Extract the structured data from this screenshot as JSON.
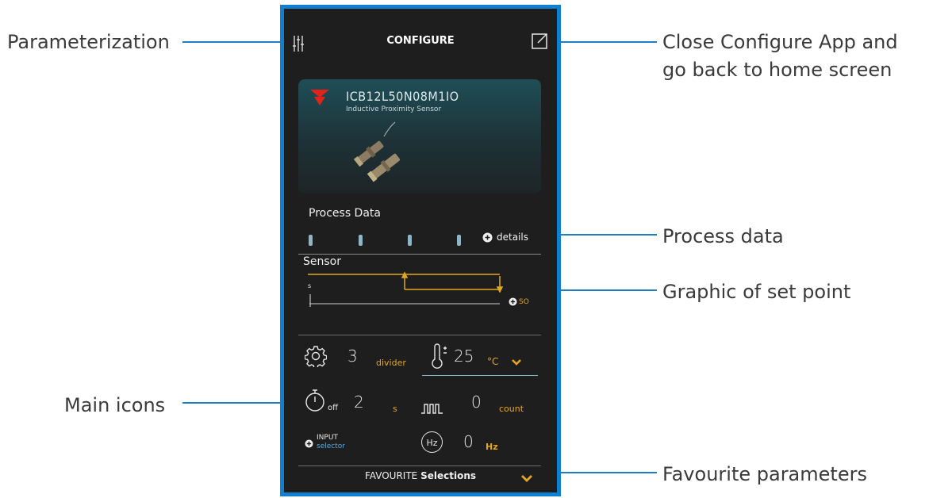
{
  "annotations": {
    "parameterization": "Parameterization",
    "close_app_line1": "Close Configure App and",
    "close_app_line2": "go back to home screen",
    "process_data": "Process data",
    "graphic_set_point": "Graphic of set point",
    "main_icons": "Main icons",
    "favourite_parameters": "Favourite parameters"
  },
  "header": {
    "title": "CONFIGURE"
  },
  "sensor_card": {
    "model": "ICB12L50N08M1IO",
    "subtitle": "Inductive Proximity Sensor"
  },
  "process_data": {
    "label": "Process Data",
    "details_label": "details"
  },
  "sensor_graph": {
    "label": "Sensor",
    "axis_start": "s",
    "set_point_label": "SO"
  },
  "main_icons": {
    "divider_value": "3",
    "divider_unit": "divider",
    "temperature_value": "25",
    "temperature_unit": "°C",
    "timer_label": "off",
    "timer_value": "2",
    "timer_unit": "s",
    "count_value": "0",
    "count_unit": "count",
    "input_label": "INPUT",
    "input_sub": "selector",
    "frequency_icon_text": "Hz",
    "frequency_value": "0",
    "frequency_unit": "Hz"
  },
  "favourites": {
    "prefix": "FAVOURITE",
    "bold": "Selections"
  },
  "colors": {
    "frame": "#0f7fd0",
    "accent": "#e2a71d",
    "screen": "#1e1e1f",
    "callout_line": "#1f7dc3"
  }
}
